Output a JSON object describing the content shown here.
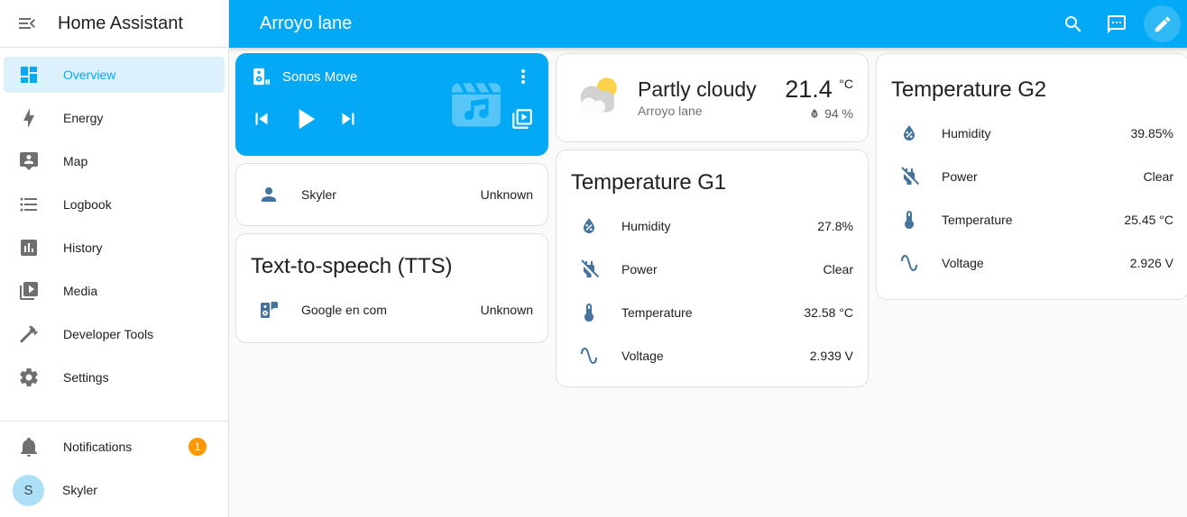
{
  "colors": {
    "primary": "#03a9f4",
    "accent": "#ff9800",
    "state-icon": "#44739e",
    "text-primary": "#212121",
    "text-secondary": "#727272",
    "divider": "#e0e0e0",
    "content-bg": "#fafafa",
    "card-bg": "#ffffff",
    "selected-bg": "#ddf1fc"
  },
  "sidebar": {
    "title": "Home Assistant",
    "items": [
      {
        "label": "Overview",
        "icon": "view-dashboard-icon",
        "active": true
      },
      {
        "label": "Energy",
        "icon": "lightning-bolt-icon",
        "active": false
      },
      {
        "label": "Map",
        "icon": "tooltip-account-icon",
        "active": false
      },
      {
        "label": "Logbook",
        "icon": "list-bulleted-icon",
        "active": false
      },
      {
        "label": "History",
        "icon": "chart-box-icon",
        "active": false
      },
      {
        "label": "Media",
        "icon": "play-box-multiple-icon",
        "active": false
      },
      {
        "label": "Developer Tools",
        "icon": "hammer-icon",
        "active": false
      },
      {
        "label": "Settings",
        "icon": "cog-icon",
        "active": false
      }
    ],
    "notifications": {
      "label": "Notifications",
      "badge": "1"
    },
    "user": {
      "name": "Skyler",
      "avatar_initial": "S"
    }
  },
  "header": {
    "title": "Arroyo lane"
  },
  "cards": {
    "media_player": {
      "name": "Sonos Move"
    },
    "person": {
      "name": "Skyler",
      "state": "Unknown"
    },
    "tts": {
      "title": "Text-to-speech (TTS)",
      "entity": "Google en com",
      "state": "Unknown"
    },
    "weather": {
      "condition": "Partly cloudy",
      "location": "Arroyo lane",
      "temperature": "21.4",
      "temperature_unit": "°C",
      "humidity": "94 %"
    },
    "temperature_g1": {
      "title": "Temperature G1",
      "rows": [
        {
          "name": "Humidity",
          "value": "27.8%",
          "icon": "water-percent-icon"
        },
        {
          "name": "Power",
          "value": "Clear",
          "icon": "power-plug-off-icon"
        },
        {
          "name": "Temperature",
          "value": "32.58 °C",
          "icon": "thermometer-icon"
        },
        {
          "name": "Voltage",
          "value": "2.939 V",
          "icon": "sine-wave-icon"
        }
      ]
    },
    "temperature_g2": {
      "title": "Temperature G2",
      "rows": [
        {
          "name": "Humidity",
          "value": "39.85%",
          "icon": "water-percent-icon"
        },
        {
          "name": "Power",
          "value": "Clear",
          "icon": "power-plug-off-icon"
        },
        {
          "name": "Temperature",
          "value": "25.45 °C",
          "icon": "thermometer-icon"
        },
        {
          "name": "Voltage",
          "value": "2.926 V",
          "icon": "sine-wave-icon"
        }
      ]
    }
  }
}
